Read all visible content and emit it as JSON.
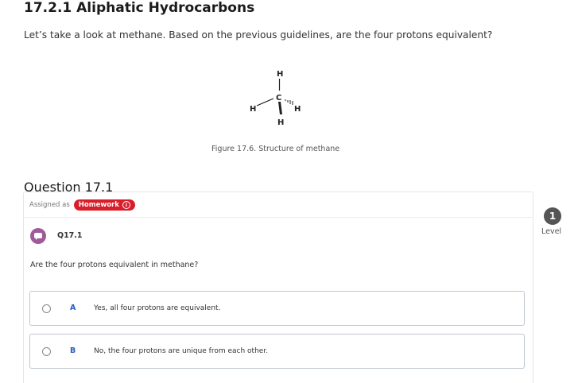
{
  "section": {
    "title": "17.2.1 Aliphatic Hydrocarbons",
    "intro": "Let’s take a look at methane. Based on the previous guidelines, are the four protons equivalent?"
  },
  "figure": {
    "atoms": {
      "top": "H",
      "center": "C",
      "left": "H",
      "right": "H",
      "bottom": "H"
    },
    "caption": "Figure 17.6. Structure of methane"
  },
  "question": {
    "heading": "Question 17.1",
    "assigned_label": "Assigned as",
    "assignment_type": "Homework",
    "id": "Q17.1",
    "prompt": "Are the four protons equivalent in methane?",
    "options": [
      {
        "letter": "A",
        "text": "Yes, all four protons are equivalent."
      },
      {
        "letter": "B",
        "text": "No, the four protons are unique from each other."
      }
    ]
  },
  "level": {
    "number": "1",
    "label": "Level"
  },
  "colors": {
    "badge": "#d81e2a",
    "option_letter": "#2a5ac5",
    "question_icon": "#a05a9c"
  }
}
